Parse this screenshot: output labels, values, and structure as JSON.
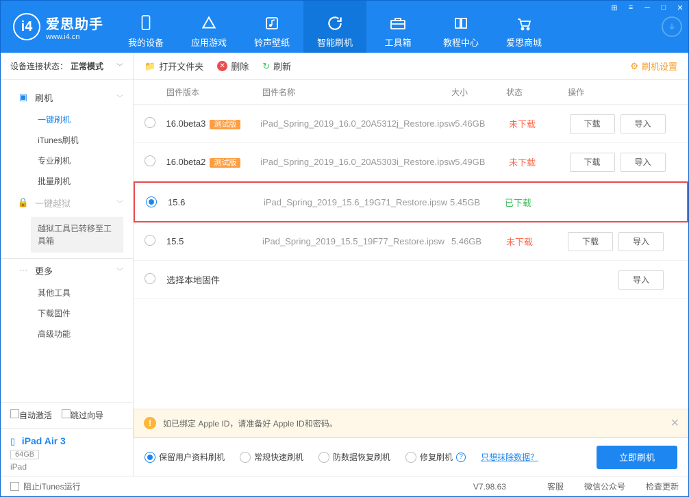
{
  "app": {
    "title": "爱思助手",
    "subtitle": "www.i4.cn"
  },
  "nav": [
    {
      "label": "我的设备",
      "icon": "phone"
    },
    {
      "label": "应用游戏",
      "icon": "apps"
    },
    {
      "label": "铃声壁纸",
      "icon": "music"
    },
    {
      "label": "智能刷机",
      "icon": "refresh",
      "active": true
    },
    {
      "label": "工具箱",
      "icon": "toolbox"
    },
    {
      "label": "教程中心",
      "icon": "book"
    },
    {
      "label": "爱思商城",
      "icon": "cart"
    }
  ],
  "status": {
    "label": "设备连接状态：",
    "value": "正常模式"
  },
  "sidebar": {
    "flash": {
      "label": "刷机",
      "items": [
        "一键刷机",
        "iTunes刷机",
        "专业刷机",
        "批量刷机"
      ],
      "active": 0
    },
    "jailbreak": {
      "label": "一键越狱",
      "note": "越狱工具已转移至工具箱"
    },
    "more": {
      "label": "更多",
      "items": [
        "其他工具",
        "下载固件",
        "高级功能"
      ]
    },
    "bottom": {
      "auto": "自动激活",
      "skip": "跳过向导"
    },
    "device": {
      "name": "iPad Air 3",
      "storage": "64GB",
      "type": "iPad"
    }
  },
  "toolbar": {
    "open": "打开文件夹",
    "delete": "删除",
    "refresh": "刷新",
    "settings": "刷机设置"
  },
  "columns": {
    "ver": "固件版本",
    "name": "固件名称",
    "size": "大小",
    "status": "状态",
    "ops": "操作"
  },
  "firmware": [
    {
      "ver": "16.0beta3",
      "beta": "测试版",
      "name": "iPad_Spring_2019_16.0_20A5312j_Restore.ipsw",
      "size": "5.46GB",
      "status": "未下载",
      "dl": true
    },
    {
      "ver": "16.0beta2",
      "beta": "测试版",
      "name": "iPad_Spring_2019_16.0_20A5303i_Restore.ipsw",
      "size": "5.49GB",
      "status": "未下载",
      "dl": true
    },
    {
      "ver": "15.6",
      "name": "iPad_Spring_2019_15.6_19G71_Restore.ipsw",
      "size": "5.45GB",
      "status": "已下载",
      "selected": true
    },
    {
      "ver": "15.5",
      "name": "iPad_Spring_2019_15.5_19F77_Restore.ipsw",
      "size": "5.46GB",
      "status": "未下载",
      "dl": true
    },
    {
      "ver": "选择本地固件",
      "local": true
    }
  ],
  "ops": {
    "download": "下载",
    "import": "导入"
  },
  "notice": "如已绑定 Apple ID，请准备好 Apple ID和密码。",
  "actions": {
    "opt1": "保留用户资料刷机",
    "opt2": "常规快速刷机",
    "opt3": "防数据恢复刷机",
    "opt4": "修复刷机",
    "erase_link": "只想抹除数据？",
    "go": "立即刷机"
  },
  "footer": {
    "block": "阻止iTunes运行",
    "version": "V7.98.63",
    "cs": "客服",
    "wx": "微信公众号",
    "update": "检查更新"
  }
}
